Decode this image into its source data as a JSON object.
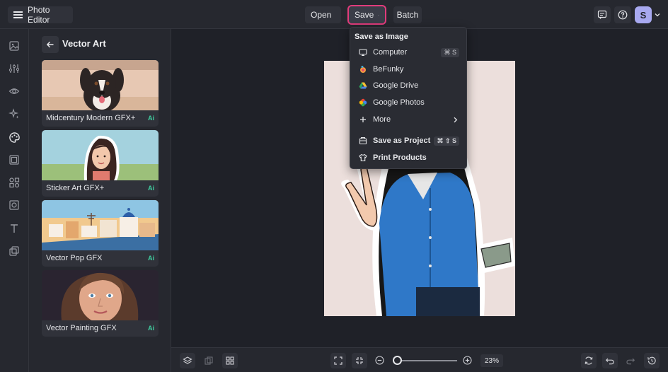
{
  "app": {
    "title": "Photo Editor"
  },
  "toolbar": {
    "open_label": "Open",
    "save_label": "Save",
    "batch_label": "Batch",
    "user_initial": "S"
  },
  "panel": {
    "title": "Vector Art",
    "cards": [
      {
        "label": "Midcentury Modern GFX+",
        "badge": "Ai"
      },
      {
        "label": "Sticker Art GFX+",
        "badge": "Ai"
      },
      {
        "label": "Vector Pop GFX",
        "badge": "Ai"
      },
      {
        "label": "Vector Painting GFX",
        "badge": "Ai"
      }
    ]
  },
  "save_menu": {
    "heading": "Save as Image",
    "items": [
      {
        "label": "Computer",
        "shortcut": "⌘ S",
        "icon": "monitor-icon"
      },
      {
        "label": "BeFunky",
        "icon": "befunky-icon"
      },
      {
        "label": "Google Drive",
        "icon": "google-drive-icon"
      },
      {
        "label": "Google Photos",
        "icon": "google-photos-icon"
      },
      {
        "label": "More",
        "icon": "plus-icon"
      },
      {
        "label": "Save as Project",
        "shortcut": "⌘ ⇧ S",
        "icon": "project-icon"
      },
      {
        "label": "Print Products",
        "icon": "tshirt-icon"
      }
    ]
  },
  "zoom": {
    "value": "23%",
    "level_percent": 23
  },
  "colors": {
    "accent": "#e23c7c",
    "ai_badge": "#3fcfa0",
    "avatar": "#a8a9f0"
  }
}
